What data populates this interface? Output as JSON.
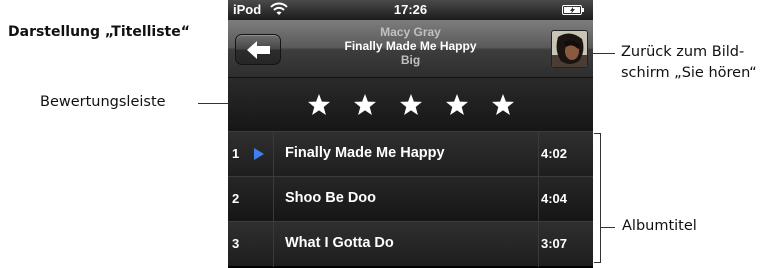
{
  "annotations": {
    "view_title": "Darstellung „Titelliste“",
    "rating_bar": "Bewertungsleiste",
    "back_to_now_playing_line1": "Zurück zum Bild-",
    "back_to_now_playing_line2": "schirm „Sie hören“",
    "album_tracks": "Albumtitel"
  },
  "status_bar": {
    "carrier": "iPod",
    "time": "17:26",
    "icons": [
      "wifi-icon",
      "battery-icon"
    ]
  },
  "now_playing": {
    "artist": "Macy Gray",
    "title": "Finally Made Me Happy",
    "album": "Big"
  },
  "rating": {
    "stars": 5,
    "icon": "star-icon"
  },
  "tracks": [
    {
      "number": "1",
      "title": "Finally Made Me Happy",
      "duration": "4:02",
      "playing": true
    },
    {
      "number": "2",
      "title": "Shoo Be Doo",
      "duration": "4:04",
      "playing": false
    },
    {
      "number": "3",
      "title": "What I Gotta Do",
      "duration": "3:07",
      "playing": false
    }
  ],
  "colors": {
    "playing_indicator": "#3f7ff0",
    "track_text": "#ffffff",
    "secondary_text": "#c0c0c0",
    "star": "#ffffff"
  }
}
